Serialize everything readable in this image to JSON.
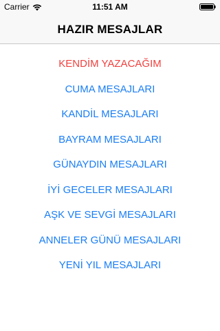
{
  "status_bar": {
    "carrier": "Carrier",
    "time": "11:51 AM",
    "wifi_icon": "wifi-icon",
    "battery_icon": "battery-icon"
  },
  "nav": {
    "title": "HAZIR MESAJLAR"
  },
  "colors": {
    "link": "#1a7ef5",
    "accent": "#f0413e"
  },
  "menu": {
    "items": [
      {
        "label": "KENDİM YAZACAĞIM",
        "accent": true
      },
      {
        "label": "CUMA MESAJLARI",
        "accent": false
      },
      {
        "label": "KANDİL MESAJLARI",
        "accent": false
      },
      {
        "label": "BAYRAM MESAJLARI",
        "accent": false
      },
      {
        "label": "GÜNAYDIN MESAJLARI",
        "accent": false
      },
      {
        "label": "İYİ GECELER MESAJLARI",
        "accent": false
      },
      {
        "label": "AŞK VE SEVGİ MESAJLARI",
        "accent": false
      },
      {
        "label": "ANNELER GÜNÜ MESAJLARI",
        "accent": false
      },
      {
        "label": "YENİ YIL MESAJLARI",
        "accent": false
      }
    ]
  }
}
